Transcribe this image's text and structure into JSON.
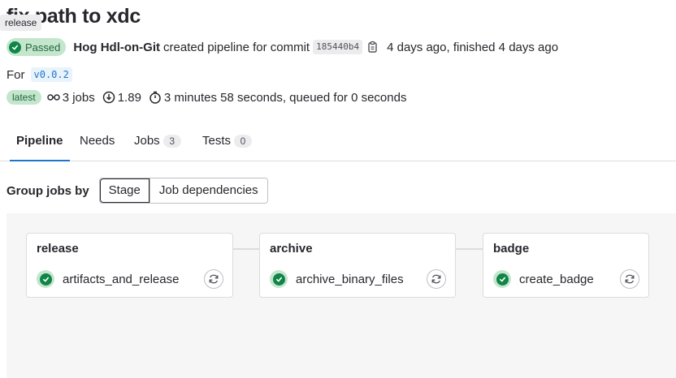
{
  "header": {
    "title": "fix path to xdc",
    "tooltip": "release"
  },
  "summary": {
    "status_label": "Passed",
    "author": "Hog Hdl-on-Git",
    "action_text": "created pipeline for commit",
    "commit_sha": "185440b4",
    "time_text": "4 days ago, finished 4 days ago",
    "for_label": "For",
    "ref": "v0.0.2",
    "latest_badge": "latest",
    "jobs_count": "3 jobs",
    "compute": "1.89",
    "duration": "3 minutes 58 seconds, queued for 0 seconds"
  },
  "tabs": [
    {
      "label": "Pipeline",
      "count": null
    },
    {
      "label": "Needs",
      "count": null
    },
    {
      "label": "Jobs",
      "count": "3"
    },
    {
      "label": "Tests",
      "count": "0"
    }
  ],
  "group_by": {
    "label": "Group jobs by",
    "options": [
      "Stage",
      "Job dependencies"
    ],
    "selected": "Stage"
  },
  "stages": [
    {
      "name": "release",
      "job": "artifacts_and_release"
    },
    {
      "name": "archive",
      "job": "archive_binary_files"
    },
    {
      "name": "badge",
      "job": "create_badge"
    }
  ],
  "colors": {
    "success": "#108548",
    "success_bg": "#c3e6cd",
    "link": "#1f75cb"
  },
  "icons": {
    "status": "check-circle-icon",
    "copy": "copy-icon",
    "jobs": "pipeline-icon",
    "compute": "compute-icon",
    "duration": "timer-icon",
    "retry": "retry-icon"
  }
}
